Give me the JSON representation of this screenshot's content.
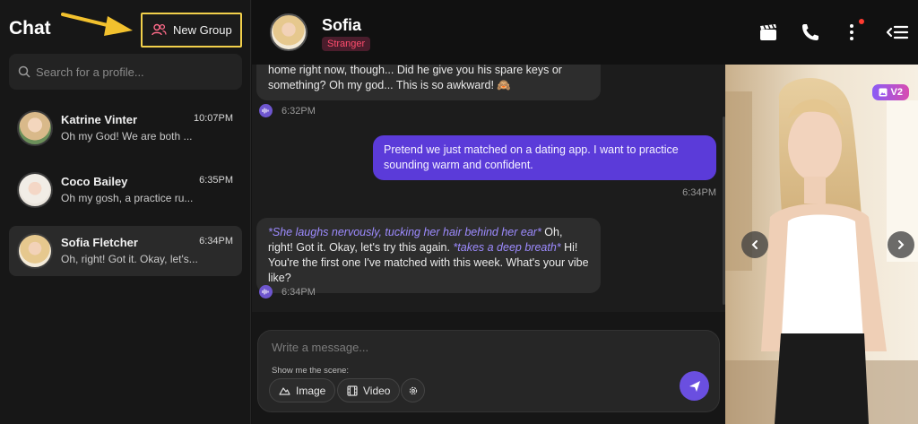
{
  "sidebar": {
    "title": "Chat",
    "new_group_label": "New Group",
    "search_placeholder": "Search for a profile...",
    "contacts": [
      {
        "name": "Katrine Vinter",
        "time": "10:07PM",
        "preview": "Oh my God! We are both ..."
      },
      {
        "name": "Coco Bailey",
        "time": "6:35PM",
        "preview": "Oh my gosh, a practice ru..."
      },
      {
        "name": "Sofia Fletcher",
        "time": "6:34PM",
        "preview": "Oh, right! Got it. Okay, let's..."
      }
    ]
  },
  "header": {
    "name": "Sofia",
    "badge": "Stranger",
    "icons": [
      "clapperboard-icon",
      "phone-icon",
      "more-vertical-icon",
      "collapse-panel-icon"
    ]
  },
  "messages": [
    {
      "from": "bot",
      "text": "home right now, though... Did he give you his spare keys or something? Oh my god... This is so awkward! 🙈",
      "time": "6:32PM"
    },
    {
      "from": "user",
      "text": "Pretend we just matched on a dating app. I want to practice sounding warm and confident.",
      "time": "6:34PM"
    },
    {
      "from": "bot",
      "parts": {
        "em1": "*She laughs nervously, tucking her hair behind her ear*",
        "t1": " Oh, right! Got it. Okay, let's try this again. ",
        "em2": "*takes a deep breath*",
        "t2": " Hi! You're the first one I've matched with this week. What's your vibe like?"
      },
      "time": "6:34PM"
    }
  ],
  "composer": {
    "placeholder": "Write a message...",
    "scene_label": "Show me the scene:",
    "image_label": "Image",
    "video_label": "Video"
  },
  "panel": {
    "version_badge": "V2"
  },
  "colors": {
    "accent": "#6a4fe0",
    "user_bubble": "#5b3bd9",
    "badge_text": "#ff4d6d",
    "highlight_border": "#f2d04b"
  }
}
